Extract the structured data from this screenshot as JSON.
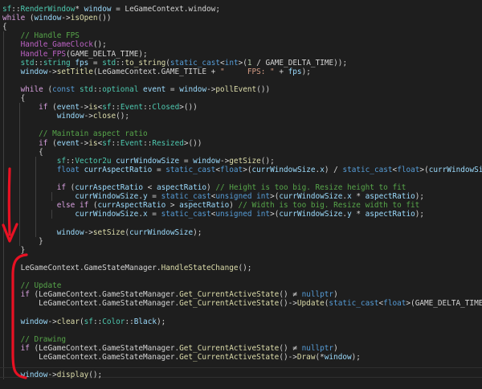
{
  "colors": {
    "background": "#1e1e1e",
    "default_text": "#d4d4d4",
    "keyword": "#569cd6",
    "control_keyword": "#d8a0df",
    "type": "#4ec9b0",
    "function": "#dcdcaa",
    "macro": "#bd63c5",
    "variable": "#9cdcfe",
    "comment": "#57a64a",
    "string": "#d69d85",
    "number": "#b5cea8",
    "annotation": "#e81123"
  },
  "code": {
    "lines": [
      [
        [
          "ty",
          "sf"
        ],
        [
          "p",
          "::"
        ],
        [
          "ty",
          "RenderWindow"
        ],
        [
          "p",
          "* "
        ],
        [
          "var",
          "window"
        ],
        [
          "p",
          " = LeGameContext.window;"
        ]
      ],
      [
        [
          "ctl",
          "while"
        ],
        [
          "p",
          " ("
        ],
        [
          "var",
          "window"
        ],
        [
          "p",
          "->"
        ],
        [
          "fn",
          "isOpen"
        ],
        [
          "p",
          "())"
        ]
      ],
      [
        [
          "p",
          "{"
        ]
      ],
      [
        [
          "p",
          "    "
        ],
        [
          "cm",
          "// Handle FPS"
        ]
      ],
      [
        [
          "p",
          "    "
        ],
        [
          "mac",
          "Handle_GameClock"
        ],
        [
          "p",
          "();"
        ]
      ],
      [
        [
          "p",
          "    "
        ],
        [
          "mac",
          "Handle_FPS"
        ],
        [
          "p",
          "(GAME_DELTA_TIME);"
        ]
      ],
      [
        [
          "p",
          "    "
        ],
        [
          "ns",
          "std"
        ],
        [
          "p",
          "::"
        ],
        [
          "ty",
          "string"
        ],
        [
          "p",
          " "
        ],
        [
          "var",
          "fps"
        ],
        [
          "p",
          " = "
        ],
        [
          "ns",
          "std"
        ],
        [
          "p",
          "::"
        ],
        [
          "fn",
          "to_string"
        ],
        [
          "p",
          "("
        ],
        [
          "kw",
          "static_cast"
        ],
        [
          "p",
          "<"
        ],
        [
          "kw",
          "int"
        ],
        [
          "p",
          ">("
        ],
        [
          "num",
          "1"
        ],
        [
          "p",
          " / GAME_DELTA_TIME));"
        ]
      ],
      [
        [
          "p",
          "    "
        ],
        [
          "var",
          "window"
        ],
        [
          "p",
          "->"
        ],
        [
          "fn",
          "setTitle"
        ],
        [
          "p",
          "(LeGameContext.GAME_TITLE + "
        ],
        [
          "str",
          "\"     FPS: \""
        ],
        [
          "p",
          " + "
        ],
        [
          "var",
          "fps"
        ],
        [
          "p",
          ");"
        ]
      ],
      [
        [
          "p",
          ""
        ]
      ],
      [
        [
          "p",
          "    "
        ],
        [
          "ctl",
          "while"
        ],
        [
          "p",
          " ("
        ],
        [
          "kw",
          "const"
        ],
        [
          "p",
          " "
        ],
        [
          "ns",
          "std"
        ],
        [
          "p",
          "::"
        ],
        [
          "ty",
          "optional"
        ],
        [
          "p",
          " "
        ],
        [
          "var",
          "event"
        ],
        [
          "p",
          " = "
        ],
        [
          "var",
          "window"
        ],
        [
          "p",
          "->"
        ],
        [
          "fn",
          "pollEvent"
        ],
        [
          "p",
          "())"
        ]
      ],
      [
        [
          "p",
          "    {"
        ]
      ],
      [
        [
          "p",
          "        "
        ],
        [
          "ctl",
          "if"
        ],
        [
          "p",
          " ("
        ],
        [
          "var",
          "event"
        ],
        [
          "p",
          "->"
        ],
        [
          "fn",
          "is"
        ],
        [
          "p",
          "<"
        ],
        [
          "ty",
          "sf"
        ],
        [
          "p",
          "::"
        ],
        [
          "ty",
          "Event"
        ],
        [
          "p",
          "::"
        ],
        [
          "ty",
          "Closed"
        ],
        [
          "p",
          ">())"
        ]
      ],
      [
        [
          "p",
          "            "
        ],
        [
          "var",
          "window"
        ],
        [
          "p",
          "->"
        ],
        [
          "fn",
          "close"
        ],
        [
          "p",
          "();"
        ]
      ],
      [
        [
          "p",
          ""
        ]
      ],
      [
        [
          "p",
          "        "
        ],
        [
          "cm",
          "// Maintain aspect ratio"
        ]
      ],
      [
        [
          "p",
          "        "
        ],
        [
          "ctl",
          "if"
        ],
        [
          "p",
          " ("
        ],
        [
          "var",
          "event"
        ],
        [
          "p",
          "->"
        ],
        [
          "fn",
          "is"
        ],
        [
          "p",
          "<"
        ],
        [
          "ty",
          "sf"
        ],
        [
          "p",
          "::"
        ],
        [
          "ty",
          "Event"
        ],
        [
          "p",
          "::"
        ],
        [
          "ty",
          "Resized"
        ],
        [
          "p",
          ">())"
        ]
      ],
      [
        [
          "p",
          "        {"
        ]
      ],
      [
        [
          "p",
          "            "
        ],
        [
          "ty",
          "sf"
        ],
        [
          "p",
          "::"
        ],
        [
          "ty",
          "Vector2u"
        ],
        [
          "p",
          " "
        ],
        [
          "var",
          "currWindowSize"
        ],
        [
          "p",
          " = "
        ],
        [
          "var",
          "window"
        ],
        [
          "p",
          "->"
        ],
        [
          "fn",
          "getSize"
        ],
        [
          "p",
          "();"
        ]
      ],
      [
        [
          "p",
          "            "
        ],
        [
          "kw",
          "float"
        ],
        [
          "p",
          " "
        ],
        [
          "var",
          "currAspectRatio"
        ],
        [
          "p",
          " = "
        ],
        [
          "kw",
          "static_cast"
        ],
        [
          "p",
          "<"
        ],
        [
          "kw",
          "float"
        ],
        [
          "p",
          ">("
        ],
        [
          "var",
          "currWindowSize"
        ],
        [
          "p",
          "."
        ],
        [
          "var",
          "x"
        ],
        [
          "p",
          ") / "
        ],
        [
          "kw",
          "static_cast"
        ],
        [
          "p",
          "<"
        ],
        [
          "kw",
          "float"
        ],
        [
          "p",
          ">("
        ],
        [
          "var",
          "currWindowSize"
        ],
        [
          "p",
          "."
        ],
        [
          "var",
          "y"
        ],
        [
          "p",
          ");"
        ]
      ],
      [
        [
          "p",
          ""
        ]
      ],
      [
        [
          "p",
          "            "
        ],
        [
          "ctl",
          "if"
        ],
        [
          "p",
          " ("
        ],
        [
          "var",
          "currAspectRatio"
        ],
        [
          "p",
          " < "
        ],
        [
          "var",
          "aspectRatio"
        ],
        [
          "p",
          ") "
        ],
        [
          "cm",
          "// Height is too big. Resize height to fit"
        ]
      ],
      [
        [
          "p",
          "                "
        ],
        [
          "var",
          "currWindowSize"
        ],
        [
          "p",
          "."
        ],
        [
          "var",
          "y"
        ],
        [
          "p",
          " = "
        ],
        [
          "kw",
          "static_cast"
        ],
        [
          "p",
          "<"
        ],
        [
          "kw",
          "unsigned int"
        ],
        [
          "p",
          ">("
        ],
        [
          "var",
          "currWindowSize"
        ],
        [
          "p",
          "."
        ],
        [
          "var",
          "x"
        ],
        [
          "p",
          " * "
        ],
        [
          "var",
          "aspectRatio"
        ],
        [
          "p",
          ");"
        ]
      ],
      [
        [
          "p",
          "            "
        ],
        [
          "ctl",
          "else if"
        ],
        [
          "p",
          " ("
        ],
        [
          "var",
          "currAspectRatio"
        ],
        [
          "p",
          " > "
        ],
        [
          "var",
          "aspectRatio"
        ],
        [
          "p",
          ") "
        ],
        [
          "cm",
          "// Width is too big. Resize width to fit"
        ]
      ],
      [
        [
          "p",
          "                "
        ],
        [
          "var",
          "currWindowSize"
        ],
        [
          "p",
          "."
        ],
        [
          "var",
          "x"
        ],
        [
          "p",
          " = "
        ],
        [
          "kw",
          "static_cast"
        ],
        [
          "p",
          "<"
        ],
        [
          "kw",
          "unsigned int"
        ],
        [
          "p",
          ">("
        ],
        [
          "var",
          "currWindowSize"
        ],
        [
          "p",
          "."
        ],
        [
          "var",
          "y"
        ],
        [
          "p",
          " * "
        ],
        [
          "var",
          "aspectRatio"
        ],
        [
          "p",
          ");"
        ]
      ],
      [
        [
          "p",
          ""
        ]
      ],
      [
        [
          "p",
          "            "
        ],
        [
          "var",
          "window"
        ],
        [
          "p",
          "->"
        ],
        [
          "fn",
          "setSize"
        ],
        [
          "p",
          "("
        ],
        [
          "var",
          "currWindowSize"
        ],
        [
          "p",
          ");"
        ]
      ],
      [
        [
          "p",
          "        }"
        ]
      ],
      [
        [
          "p",
          "    }"
        ]
      ],
      [
        [
          "p",
          ""
        ]
      ],
      [
        [
          "p",
          "    LeGameContext.GameStateManager."
        ],
        [
          "fn",
          "HandleStateChange"
        ],
        [
          "p",
          "();"
        ]
      ],
      [
        [
          "p",
          ""
        ]
      ],
      [
        [
          "p",
          "    "
        ],
        [
          "cm",
          "// Update"
        ]
      ],
      [
        [
          "p",
          "    "
        ],
        [
          "ctl",
          "if"
        ],
        [
          "p",
          " (LeGameContext.GameStateManager."
        ],
        [
          "fn",
          "Get_CurrentActiveState"
        ],
        [
          "p",
          "() ≠ "
        ],
        [
          "kw",
          "nullptr"
        ],
        [
          "p",
          ")"
        ]
      ],
      [
        [
          "p",
          "        LeGameContext.GameStateManager."
        ],
        [
          "fn",
          "Get_CurrentActiveState"
        ],
        [
          "p",
          "()->"
        ],
        [
          "fn",
          "Update"
        ],
        [
          "p",
          "("
        ],
        [
          "kw",
          "static_cast"
        ],
        [
          "p",
          "<"
        ],
        [
          "kw",
          "float"
        ],
        [
          "p",
          ">(GAME_DELTA_TIME));"
        ]
      ],
      [
        [
          "p",
          ""
        ]
      ],
      [
        [
          "p",
          "    "
        ],
        [
          "var",
          "window"
        ],
        [
          "p",
          "->"
        ],
        [
          "fn",
          "clear"
        ],
        [
          "p",
          "("
        ],
        [
          "ty",
          "sf"
        ],
        [
          "p",
          "::"
        ],
        [
          "ty",
          "Color"
        ],
        [
          "p",
          "::"
        ],
        [
          "var",
          "Black"
        ],
        [
          "p",
          ");"
        ]
      ],
      [
        [
          "p",
          ""
        ]
      ],
      [
        [
          "p",
          "    "
        ],
        [
          "cm",
          "// Drawing"
        ]
      ],
      [
        [
          "p",
          "    "
        ],
        [
          "ctl",
          "if"
        ],
        [
          "p",
          " (LeGameContext.GameStateManager."
        ],
        [
          "fn",
          "Get_CurrentActiveState"
        ],
        [
          "p",
          "() ≠ "
        ],
        [
          "kw",
          "nullptr"
        ],
        [
          "p",
          ")"
        ]
      ],
      [
        [
          "p",
          "        LeGameContext.GameStateManager."
        ],
        [
          "fn",
          "Get_CurrentActiveState"
        ],
        [
          "p",
          "()->"
        ],
        [
          "fn",
          "Draw"
        ],
        [
          "p",
          "(*"
        ],
        [
          "var",
          "window"
        ],
        [
          "p",
          ");"
        ]
      ],
      [
        [
          "p",
          ""
        ]
      ],
      [
        [
          "p",
          "    "
        ],
        [
          "var",
          "window"
        ],
        [
          "p",
          "->"
        ],
        [
          "fn",
          "display"
        ],
        [
          "p",
          "();"
        ]
      ]
    ]
  }
}
